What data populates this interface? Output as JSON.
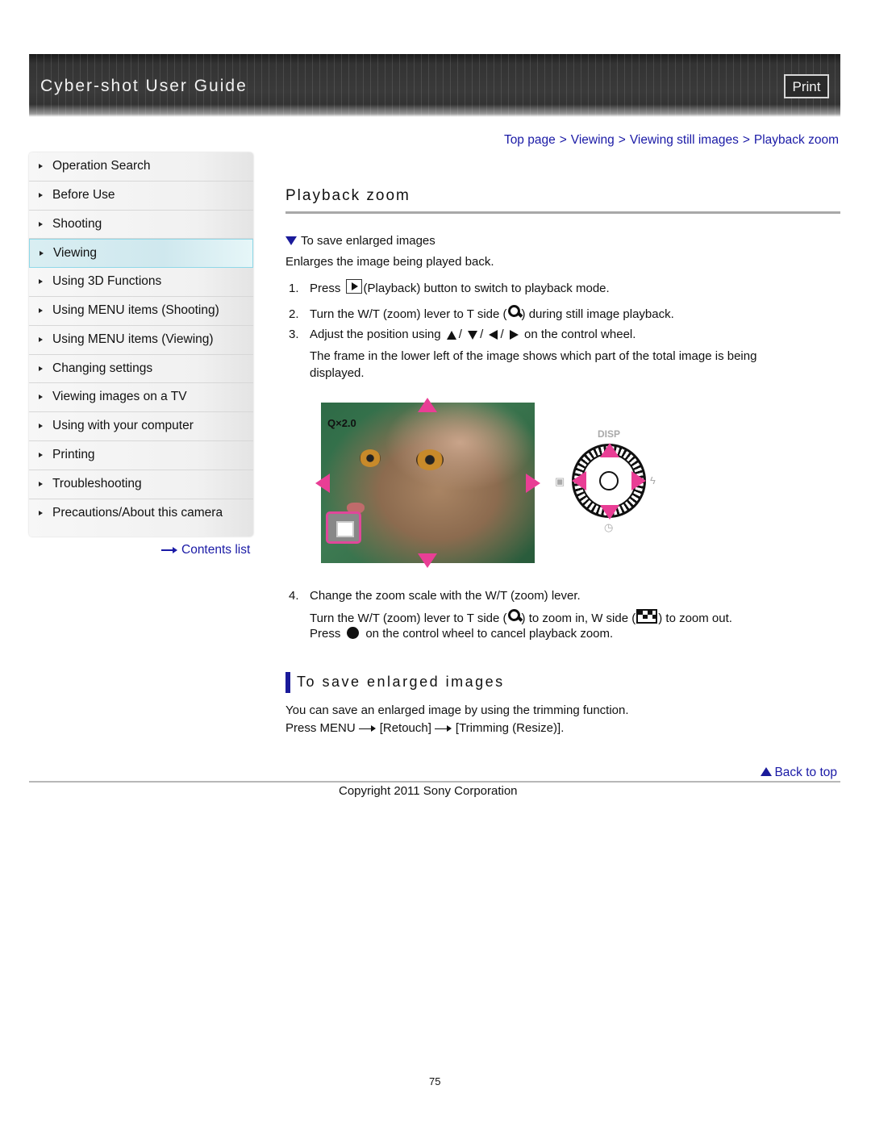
{
  "header": {
    "title": "Cyber-shot User Guide",
    "print_label": "Print"
  },
  "breadcrumb": [
    {
      "label": "Top page"
    },
    {
      "label": "Viewing"
    },
    {
      "label": "Viewing still images"
    },
    {
      "label": "Playback zoom"
    }
  ],
  "breadcrumb_separator": ">",
  "sidebar": {
    "active_index": 3,
    "items": [
      {
        "label": "Operation Search"
      },
      {
        "label": "Before Use"
      },
      {
        "label": "Shooting"
      },
      {
        "label": "Viewing"
      },
      {
        "label": "Using 3D Functions"
      },
      {
        "label": "Using MENU items (Shooting)"
      },
      {
        "label": "Using MENU items (Viewing)"
      },
      {
        "label": "Changing settings"
      },
      {
        "label": "Viewing images on a TV"
      },
      {
        "label": "Using with your computer"
      },
      {
        "label": "Printing"
      },
      {
        "label": "Troubleshooting"
      },
      {
        "label": "Precautions/About this camera"
      }
    ],
    "contents_link": "Contents list"
  },
  "main": {
    "title": "Playback zoom",
    "jump_link": "To save enlarged images",
    "intro": "Enlarges the image being played back.",
    "steps": [
      {
        "num": "1.",
        "before": "Press",
        "icon": "playback-icon",
        "after": "(Playback) button to switch to playback mode."
      },
      {
        "num": "2.",
        "before": "Turn the W/T (zoom) lever to T side (",
        "icon": "zoom-in-icon",
        "after": ") during still image playback."
      },
      {
        "num": "3.",
        "before": "Adjust the position using",
        "icons": [
          "up",
          "down",
          "left",
          "right"
        ],
        "separator": "/",
        "after": "on the control wheel.",
        "note": "The frame in the lower left of the image shows which part of the total image is being displayed."
      },
      {
        "num": "4.",
        "text": "Change the zoom scale with the W/T (zoom) lever.",
        "line2_a": "Turn the W/T (zoom) lever to T side (",
        "line2_b": ") to zoom in, W side (",
        "line2_c": ") to zoom out.",
        "line3_a": "Press",
        "line3_b": "on the control wheel to cancel playback zoom."
      }
    ],
    "illustration": {
      "zoom_indicator": "Q×2.0",
      "disp_label": "DISP",
      "accent_color": "#e93e95"
    }
  },
  "section": {
    "title": "To save enlarged images",
    "text": "You can save an enlarged image by using the trimming function.",
    "path": [
      "Press MENU",
      "[Retouch]",
      "[Trimming (Resize)]."
    ]
  },
  "footer": {
    "back_to_top": "Back to top",
    "copyright": "Copyright 2011 Sony Corporation",
    "page_number": "75"
  },
  "colors": {
    "link": "#1a1aa6",
    "accent_bar": "#1a1a9a",
    "active_item_border": "#8fd8e8"
  }
}
